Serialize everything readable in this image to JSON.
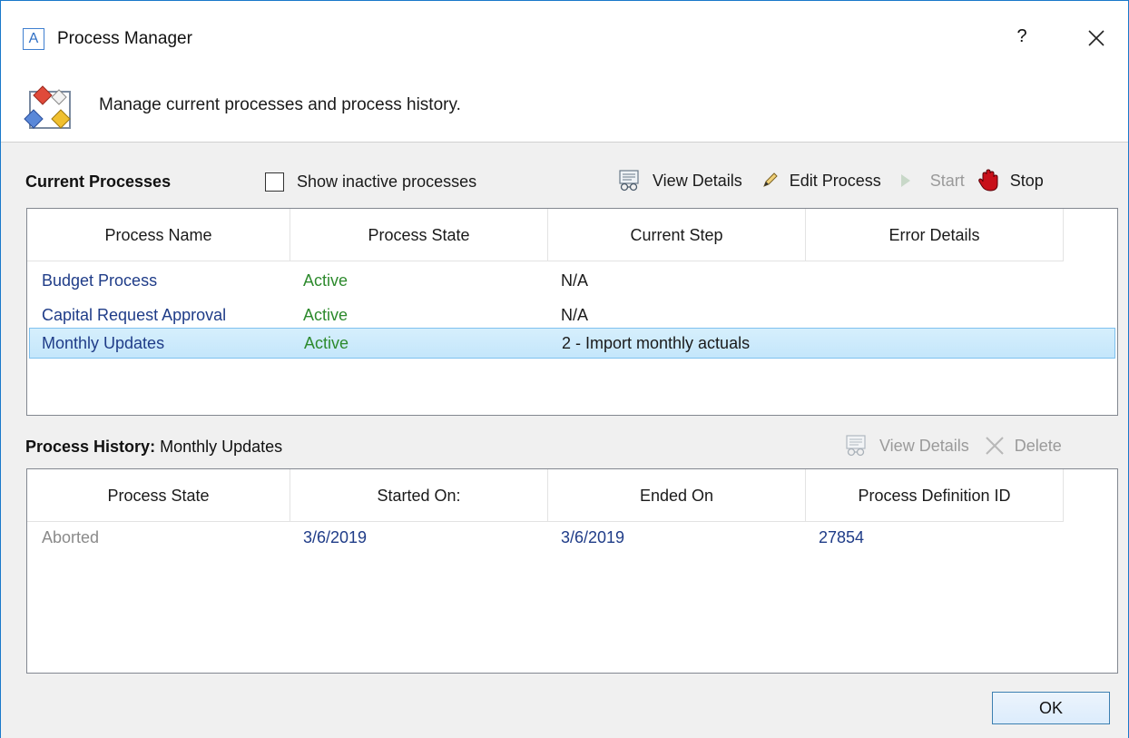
{
  "window": {
    "title": "Process Manager",
    "logo_letter": "A",
    "help_label": "?",
    "header_text": "Manage current processes and process history."
  },
  "current": {
    "section_label": "Current Processes",
    "show_inactive_label": "Show inactive processes",
    "show_inactive_checked": false,
    "toolbar": {
      "view_details": "View Details",
      "edit_process": "Edit Process",
      "start": "Start",
      "stop": "Stop"
    },
    "columns": [
      "Process Name",
      "Process State",
      "Current Step",
      "Error Details"
    ],
    "rows": [
      {
        "name": "Budget Process",
        "state": "Active",
        "step": "N/A",
        "error": ""
      },
      {
        "name": "Capital Request Approval",
        "state": "Active",
        "step": "N/A",
        "error": ""
      },
      {
        "name": "Monthly Updates",
        "state": "Active",
        "step": "2 - Import monthly actuals",
        "error": ""
      }
    ],
    "selected_row": 2
  },
  "history": {
    "section_label": "Process History:",
    "section_subject": "Monthly Updates",
    "toolbar": {
      "view_details": "View Details",
      "delete": "Delete"
    },
    "columns": [
      "Process State",
      "Started On:",
      "Ended On",
      "Process Definition ID"
    ],
    "rows": [
      {
        "state": "Aborted",
        "started": "3/6/2019",
        "ended": "3/6/2019",
        "def_id": "27854"
      }
    ]
  },
  "footer": {
    "ok_label": "OK"
  },
  "colors": {
    "accent_border": "#1979ca",
    "active_green": "#2d8a2d",
    "link_blue": "#1f3c88",
    "selection": "#c4e6fb"
  },
  "icons": {
    "logo": "app-logo-icon",
    "header": "process-manager-icon",
    "view_details": "view-details-icon",
    "edit": "pencil-icon",
    "start": "play-icon",
    "stop": "stop-hand-icon",
    "delete": "delete-x-icon",
    "close": "close-icon"
  }
}
